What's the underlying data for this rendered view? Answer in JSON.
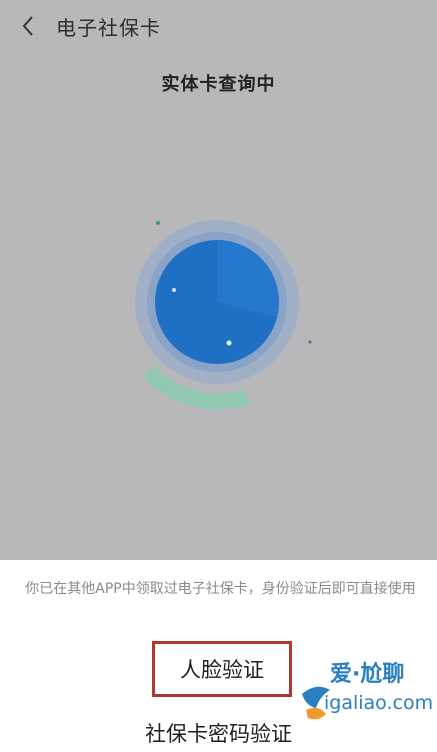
{
  "header": {
    "title": "电子社保卡",
    "back_icon": "chevron-left-icon"
  },
  "status": {
    "title": "实体卡查询中"
  },
  "sheet": {
    "notice": "你已在其他APP中领取过电子社保卡，身份验证后即可直接使用",
    "face_verify_label": "人脸验证",
    "password_verify_label": "社保卡密码验证"
  },
  "watermark": {
    "brand": "爱·尬聊",
    "url": "igaliao.com"
  },
  "colors": {
    "scan_blue": "#1f6fc4",
    "highlight_border": "#b2372f",
    "watermark_blue": "#2a7fc0"
  }
}
